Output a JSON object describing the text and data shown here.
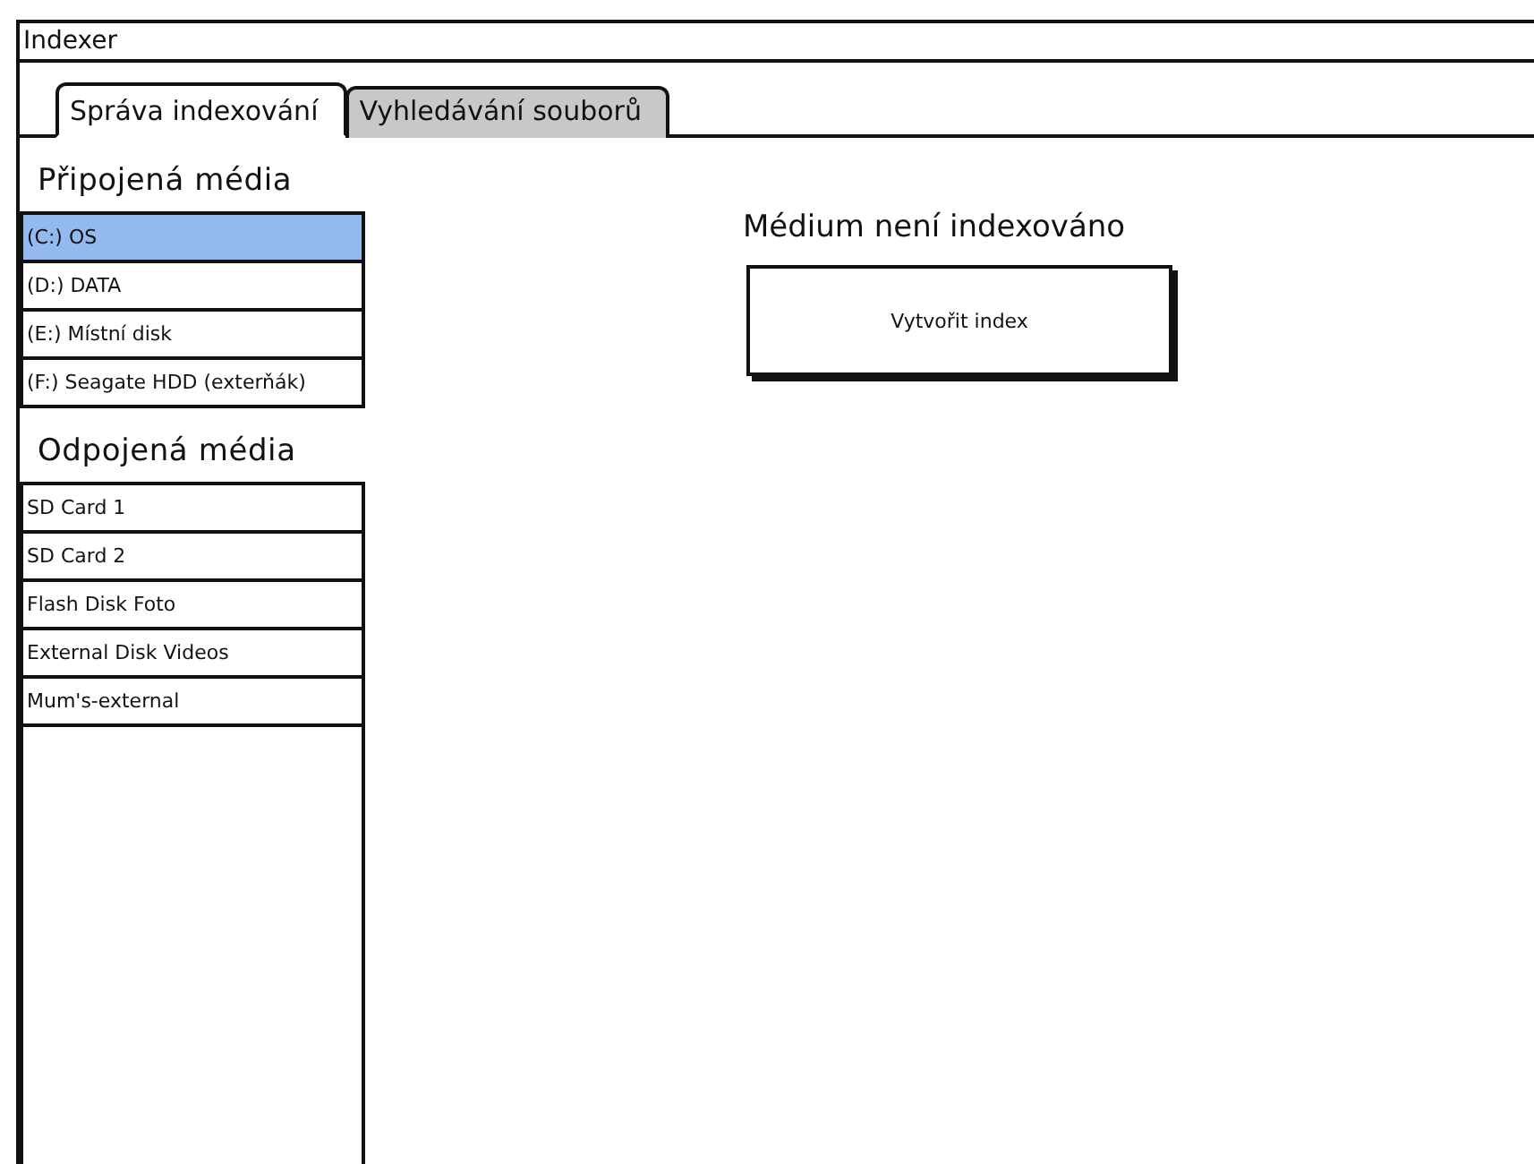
{
  "window": {
    "title": "Indexer"
  },
  "tabs": [
    {
      "label": "Správa indexování",
      "selected": true
    },
    {
      "label": "Vyhledávání souborů",
      "selected": false
    }
  ],
  "connected_media": {
    "heading": "Připojená média",
    "items": [
      {
        "label": "(C:) OS",
        "selected": true
      },
      {
        "label": "(D:) DATA",
        "selected": false
      },
      {
        "label": "(E:) Místní disk",
        "selected": false
      },
      {
        "label": "(F:) Seagate HDD (exterňák)",
        "selected": false
      }
    ]
  },
  "disconnected_media": {
    "heading": "Odpojená média",
    "items": [
      {
        "label": "SD Card 1",
        "selected": false
      },
      {
        "label": "SD Card 2",
        "selected": false
      },
      {
        "label": "Flash Disk Foto",
        "selected": false
      },
      {
        "label": "External Disk Videos",
        "selected": false
      },
      {
        "label": "Mum's-external",
        "selected": false
      }
    ]
  },
  "detail": {
    "message": "Médium není indexováno",
    "button": "Vytvořit index"
  }
}
